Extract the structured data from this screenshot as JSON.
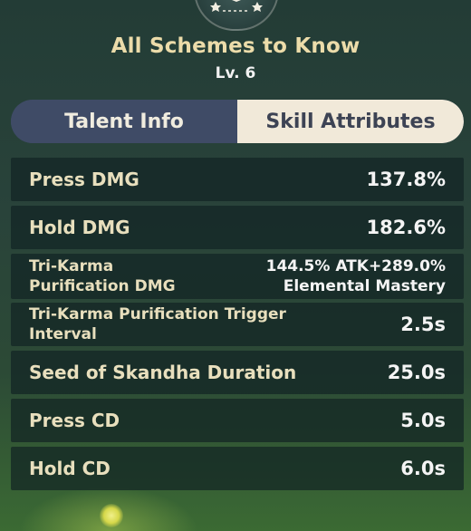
{
  "header": {
    "title": "All Schemes to Know",
    "level": "Lv. 6"
  },
  "tabs": [
    {
      "label": "Talent Info",
      "active": false
    },
    {
      "label": "Skill Attributes",
      "active": true
    }
  ],
  "attributes": [
    {
      "label": "Press DMG",
      "value": "137.8%"
    },
    {
      "label": "Hold DMG",
      "value": "182.6%"
    },
    {
      "label_line1": "Tri-Karma",
      "label_line2": "Purification DMG",
      "value_line1": "144.5% ATK+289.0%",
      "value_line2": "Elemental Mastery"
    },
    {
      "label_line1": "Tri-Karma Purification Trigger",
      "label_line2": "Interval",
      "value": "2.5s"
    },
    {
      "label": "Seed of Skandha Duration",
      "value": "25.0s"
    },
    {
      "label": "Press CD",
      "value": "5.0s"
    },
    {
      "label": "Hold CD",
      "value": "6.0s"
    }
  ],
  "colors": {
    "title": "#ecdcaa",
    "label": "#e8dfbd",
    "value": "#f4f4f4",
    "active_tab_bg": "#f1e9d9",
    "inactive_tab_bg": "#3f4b66"
  }
}
